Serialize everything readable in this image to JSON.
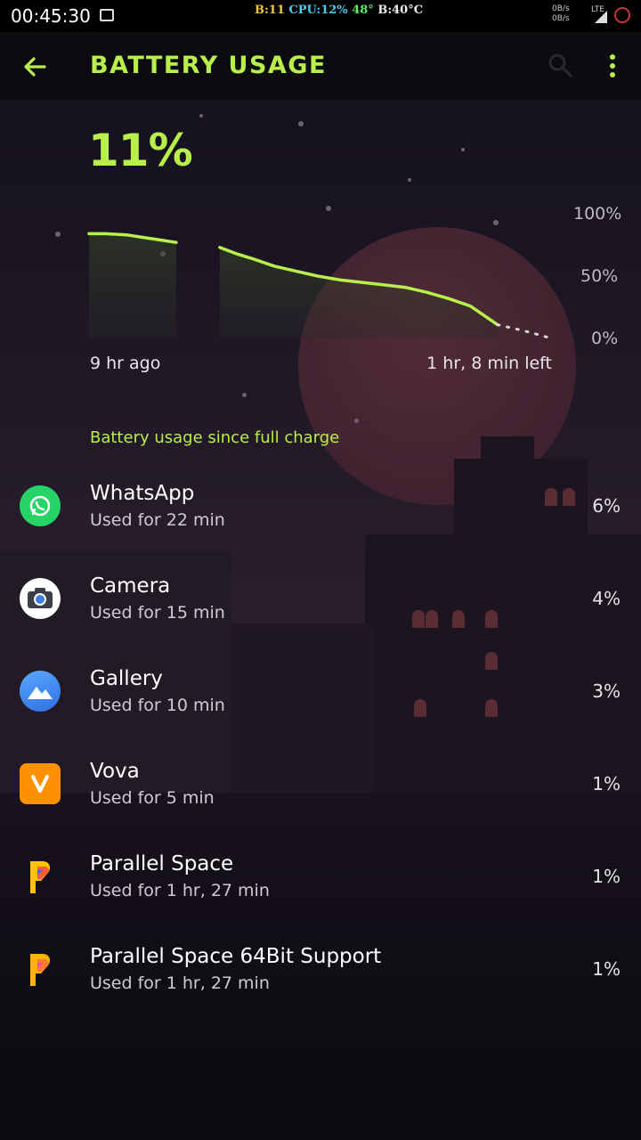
{
  "status_bar": {
    "time": "00:45:30",
    "stat_b": "B:11",
    "stat_cpu": "CPU:12%",
    "stat_temp_cpu": "48°",
    "stat_battery_temp": "B:40°C",
    "net_up": "0B/s",
    "net_down": "0B/s",
    "network_type": "LTE"
  },
  "app_bar": {
    "title": "BATTERY USAGE",
    "back_icon": "arrow-left-icon",
    "search_icon": "search-icon",
    "more_icon": "more-vert-icon"
  },
  "battery": {
    "percent": "11%",
    "time_ago_label": "9 hr ago",
    "time_left_label": "1 hr, 8 min left",
    "y_ticks": [
      "100%",
      "50%",
      "0%"
    ]
  },
  "chart_data": {
    "type": "area",
    "ylabel": "",
    "xlabel": "",
    "ylim": [
      0,
      100
    ],
    "x_unit": "hours",
    "series": [
      {
        "segment": 1,
        "x": [
          0,
          0.3,
          0.7,
          1.0,
          1.3,
          1.6
        ],
        "y": [
          84,
          84,
          83,
          81,
          79,
          77
        ]
      },
      {
        "segment": 2,
        "x": [
          2.4,
          2.7,
          3.0,
          3.4,
          3.8,
          4.2,
          4.6,
          5.0,
          5.4,
          5.8,
          6.2,
          6.6,
          7.0,
          7.5
        ],
        "y": [
          73,
          68,
          64,
          58,
          54,
          50,
          47,
          45,
          43,
          41,
          37,
          32,
          26,
          11
        ]
      },
      {
        "segment": "projection",
        "x": [
          7.5,
          8.0,
          8.5
        ],
        "y": [
          11,
          6,
          0
        ],
        "dotted": true
      }
    ],
    "color": "#b8ef4a"
  },
  "section_header": "Battery usage since full charge",
  "apps": [
    {
      "name": "WhatsApp",
      "used": "Used for 22 min",
      "percent": "6%",
      "icon": "whatsapp-icon",
      "color": "#25d366"
    },
    {
      "name": "Camera",
      "used": "Used for 15 min",
      "percent": "4%",
      "icon": "camera-icon",
      "color": "#ffffff"
    },
    {
      "name": "Gallery",
      "used": "Used for 10 min",
      "percent": "3%",
      "icon": "gallery-icon",
      "color": "#3d8bf0"
    },
    {
      "name": "Vova",
      "used": "Used for 5 min",
      "percent": "1%",
      "icon": "vova-icon",
      "color": "#ff9100"
    },
    {
      "name": "Parallel Space",
      "used": "Used for 1 hr, 27 min",
      "percent": "1%",
      "icon": "parallel-space-icon",
      "color": "#ffc400"
    },
    {
      "name": "Parallel Space 64Bit Support",
      "used": "Used for 1 hr, 27 min",
      "percent": "1%",
      "icon": "parallel-space-64bit-icon",
      "color": "#ff7a2e"
    }
  ]
}
